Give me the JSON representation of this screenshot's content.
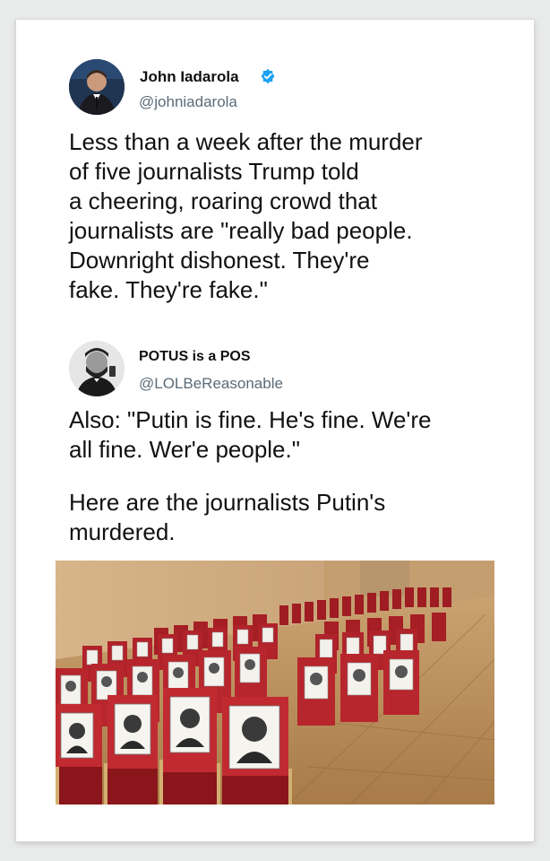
{
  "tweet": {
    "author_name": "John Iadarola",
    "author_handle": "@johniadarola",
    "verified_icon": "verified-badge-icon",
    "text": "Less than a week after the murder\nof five journalists Trump told\na cheering, roaring crowd that\njournalists are \"really bad people.\nDownright dishonest. They're\nfake. They're fake.\""
  },
  "reply": {
    "author_name": "POTUS is a POS",
    "author_handle": "@LOLBeReasonable",
    "text_1": "Also: \"Putin is fine. He's fine. We're\nall fine. Wer'e people.\"",
    "text_2": "Here are the journalists Putin's\nmurdered."
  },
  "photo": {
    "description_icon": "photo-of-empty-chairs-with-portraits",
    "accent": "#b3202a"
  },
  "colors": {
    "background": "#e9eaea",
    "verified": "#1da1f2",
    "handle": "#5b6b78"
  }
}
